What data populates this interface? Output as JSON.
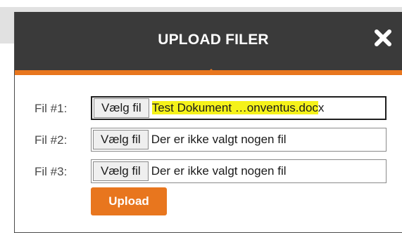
{
  "dialog": {
    "title": "UPLOAD FILER",
    "close_icon": "close-x-icon",
    "accent_color": "#e8761e",
    "header_color": "#3a3a3a"
  },
  "files": [
    {
      "label": "Fil #1:",
      "choose_label": "Vælg fil",
      "file_text_highlighted": "Test Dokument …onventus.doc",
      "file_text_tail": "x"
    },
    {
      "label": "Fil #2:",
      "choose_label": "Vælg fil",
      "file_text": "Der er ikke valgt nogen fil"
    },
    {
      "label": "Fil #3:",
      "choose_label": "Vælg fil",
      "file_text": "Der er ikke valgt nogen fil"
    }
  ],
  "upload_label": "Upload"
}
